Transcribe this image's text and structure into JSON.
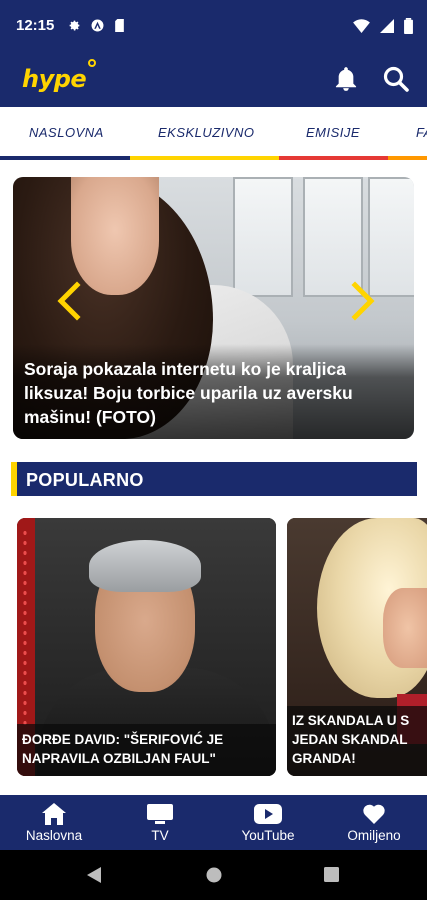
{
  "status_bar": {
    "time": "12:15"
  },
  "app_bar": {
    "logo": "hype"
  },
  "tabs": [
    {
      "label": "NASLOVNA",
      "color": "#1a2a6c"
    },
    {
      "label": "EKSKLUZIVNO",
      "color": "#ffd400"
    },
    {
      "label": "EMISIJE",
      "color": "#e53935"
    },
    {
      "label": "FA",
      "color": "#ff9800"
    }
  ],
  "hero": {
    "title_line1": "Soraja pokazala internetu ko je kraljica",
    "title_line2": "liksuza! Boju torbice uparila uz aversku",
    "title_line3": "mašinu! (FOTO)"
  },
  "section": {
    "title": "POPULARNO"
  },
  "cards": [
    {
      "line1": "ĐORĐE DAVID: \"ŠERIFOVIĆ JE",
      "line2": "NAPRAVILA OZBILJAN FAUL\""
    },
    {
      "line1": "IZ SKANDALA U S",
      "line2": "JEDAN SKANDAL",
      "line3": "GRANDA!"
    }
  ],
  "bottom_nav": [
    {
      "label": "Naslovna"
    },
    {
      "label": "TV"
    },
    {
      "label": "YouTube"
    },
    {
      "label": "Omiljeno"
    }
  ],
  "colors": {
    "brand_navy": "#1a2a6c",
    "brand_yellow": "#ffd400"
  }
}
